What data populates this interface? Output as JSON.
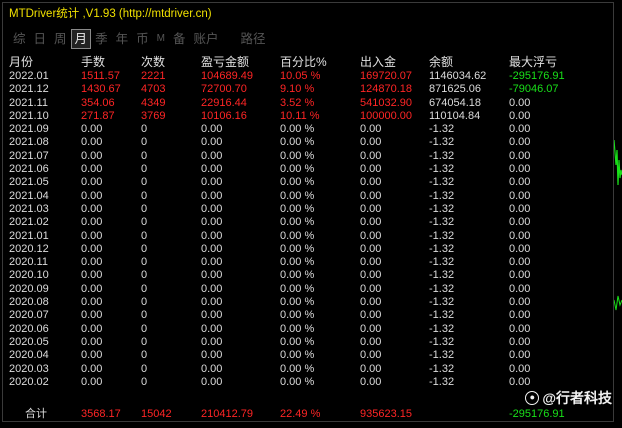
{
  "window": {
    "title": "MTDriver统计 ,V1.93 (http://mtdriver.cn)"
  },
  "tabs": [
    {
      "label": "综",
      "active": false
    },
    {
      "label": "日",
      "active": false
    },
    {
      "label": "周",
      "active": false
    },
    {
      "label": "月",
      "active": true
    },
    {
      "label": "季",
      "active": false
    },
    {
      "label": "年",
      "active": false
    },
    {
      "label": "币",
      "active": false
    },
    {
      "label": "M",
      "active": false
    },
    {
      "label": "备",
      "active": false
    },
    {
      "label": "账户",
      "active": false
    },
    {
      "label": "路径",
      "active": false
    }
  ],
  "table": {
    "headers": [
      "月份",
      "手数",
      "次数",
      "盈亏金额",
      "百分比%",
      "出入金",
      "余额",
      "最大浮亏"
    ],
    "rows": [
      [
        "2022.01",
        "1511.57",
        "2221",
        "104689.49",
        "10.05 %",
        "169720.07",
        "1146034.62",
        "-295176.91"
      ],
      [
        "2021.12",
        "1430.67",
        "4703",
        "72700.70",
        "9.10 %",
        "124870.18",
        "871625.06",
        "-79046.07"
      ],
      [
        "2021.11",
        "354.06",
        "4349",
        "22916.44",
        "3.52 %",
        "541032.90",
        "674054.18",
        "0.00"
      ],
      [
        "2021.10",
        "271.87",
        "3769",
        "10106.16",
        "10.11 %",
        "100000.00",
        "110104.84",
        "0.00"
      ],
      [
        "2021.09",
        "0.00",
        "0",
        "0.00",
        "0.00 %",
        "0.00",
        "-1.32",
        "0.00"
      ],
      [
        "2021.08",
        "0.00",
        "0",
        "0.00",
        "0.00 %",
        "0.00",
        "-1.32",
        "0.00"
      ],
      [
        "2021.07",
        "0.00",
        "0",
        "0.00",
        "0.00 %",
        "0.00",
        "-1.32",
        "0.00"
      ],
      [
        "2021.06",
        "0.00",
        "0",
        "0.00",
        "0.00 %",
        "0.00",
        "-1.32",
        "0.00"
      ],
      [
        "2021.05",
        "0.00",
        "0",
        "0.00",
        "0.00 %",
        "0.00",
        "-1.32",
        "0.00"
      ],
      [
        "2021.04",
        "0.00",
        "0",
        "0.00",
        "0.00 %",
        "0.00",
        "-1.32",
        "0.00"
      ],
      [
        "2021.03",
        "0.00",
        "0",
        "0.00",
        "0.00 %",
        "0.00",
        "-1.32",
        "0.00"
      ],
      [
        "2021.02",
        "0.00",
        "0",
        "0.00",
        "0.00 %",
        "0.00",
        "-1.32",
        "0.00"
      ],
      [
        "2021.01",
        "0.00",
        "0",
        "0.00",
        "0.00 %",
        "0.00",
        "-1.32",
        "0.00"
      ],
      [
        "2020.12",
        "0.00",
        "0",
        "0.00",
        "0.00 %",
        "0.00",
        "-1.32",
        "0.00"
      ],
      [
        "2020.11",
        "0.00",
        "0",
        "0.00",
        "0.00 %",
        "0.00",
        "-1.32",
        "0.00"
      ],
      [
        "2020.10",
        "0.00",
        "0",
        "0.00",
        "0.00 %",
        "0.00",
        "-1.32",
        "0.00"
      ],
      [
        "2020.09",
        "0.00",
        "0",
        "0.00",
        "0.00 %",
        "0.00",
        "-1.32",
        "0.00"
      ],
      [
        "2020.08",
        "0.00",
        "0",
        "0.00",
        "0.00 %",
        "0.00",
        "-1.32",
        "0.00"
      ],
      [
        "2020.07",
        "0.00",
        "0",
        "0.00",
        "0.00 %",
        "0.00",
        "-1.32",
        "0.00"
      ],
      [
        "2020.06",
        "0.00",
        "0",
        "0.00",
        "0.00 %",
        "0.00",
        "-1.32",
        "0.00"
      ],
      [
        "2020.05",
        "0.00",
        "0",
        "0.00",
        "0.00 %",
        "0.00",
        "-1.32",
        "0.00"
      ],
      [
        "2020.04",
        "0.00",
        "0",
        "0.00",
        "0.00 %",
        "0.00",
        "-1.32",
        "0.00"
      ],
      [
        "2020.03",
        "0.00",
        "0",
        "0.00",
        "0.00 %",
        "0.00",
        "-1.32",
        "0.00"
      ],
      [
        "2020.02",
        "0.00",
        "0",
        "0.00",
        "0.00 %",
        "0.00",
        "-1.32",
        "0.00"
      ]
    ],
    "footer": [
      "合计",
      "3568.17",
      "15042",
      "210412.79",
      "22.49 %",
      "935623.15",
      "",
      "-295176.91"
    ]
  },
  "watermark": {
    "text": "@行者科技",
    "icon": "weibo-logo-icon"
  },
  "colors": {
    "title": "#f0e000",
    "positive": "#ff2525",
    "negative": "#19e019",
    "text": "#dcdcdc",
    "chart_line": "#19e019"
  }
}
